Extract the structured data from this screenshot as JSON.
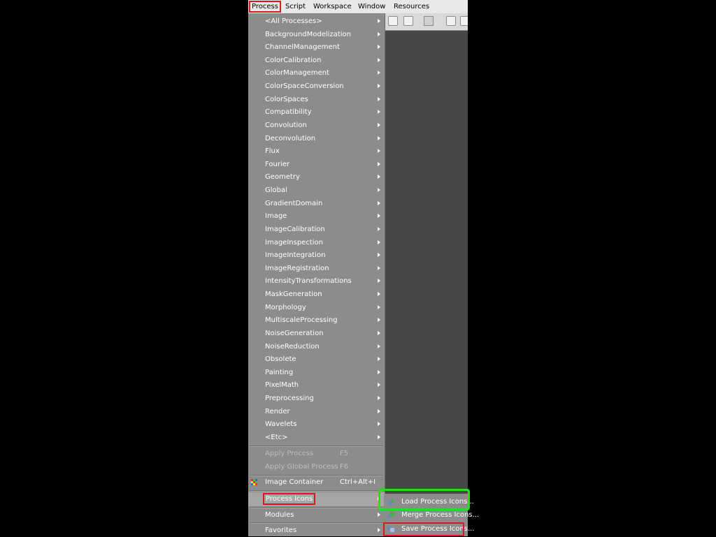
{
  "menubar": {
    "items": [
      {
        "label": "Process"
      },
      {
        "label": "Script"
      },
      {
        "label": "Workspace"
      },
      {
        "label": "Window"
      },
      {
        "label": "Resources"
      }
    ]
  },
  "process_menu": {
    "categories": [
      "<All Processes>",
      "BackgroundModelization",
      "ChannelManagement",
      "ColorCalibration",
      "ColorManagement",
      "ColorSpaceConversion",
      "ColorSpaces",
      "Compatibility",
      "Convolution",
      "Deconvolution",
      "Flux",
      "Fourier",
      "Geometry",
      "Global",
      "GradientDomain",
      "Image",
      "ImageCalibration",
      "ImageInspection",
      "ImageIntegration",
      "ImageRegistration",
      "IntensityTransformations",
      "MaskGeneration",
      "Morphology",
      "MultiscaleProcessing",
      "NoiseGeneration",
      "NoiseReduction",
      "Obsolete",
      "Painting",
      "PixelMath",
      "Preprocessing",
      "Render",
      "Wavelets",
      "<Etc>"
    ],
    "apply_process": {
      "label": "Apply Process",
      "shortcut": "F5"
    },
    "apply_global": {
      "label": "Apply Global Process",
      "shortcut": "F6"
    },
    "image_container": {
      "label": "Image Container",
      "shortcut": "Ctrl+Alt+I",
      "icon": "grid-icon"
    },
    "process_icons": {
      "label": "Process Icons"
    },
    "modules": {
      "label": "Modules"
    },
    "favorites": {
      "label": "Favorites"
    }
  },
  "process_icons_submenu": {
    "items": [
      {
        "label": "Load Process Icons...",
        "icon": "load-icon"
      },
      {
        "label": "Merge Process Icons...",
        "icon": "merge-icon"
      },
      {
        "label": "Save Process Icons...",
        "icon": "save-icon"
      }
    ]
  },
  "colors": {
    "highlight_red": "#e0141e",
    "highlight_green": "#22e01c",
    "menu_bg": "#8c8c8c"
  }
}
